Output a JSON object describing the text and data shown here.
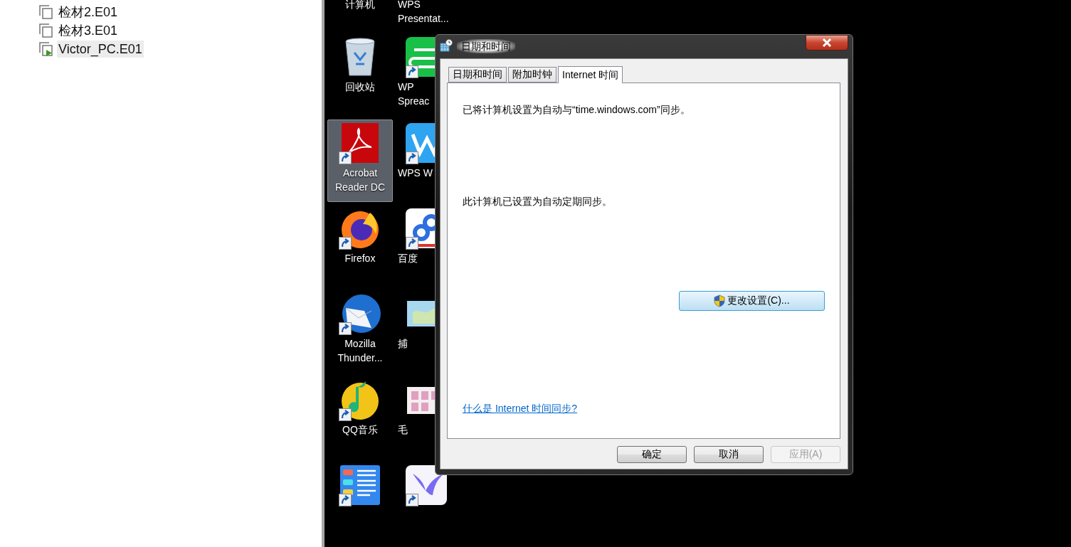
{
  "file_tree": {
    "items": [
      {
        "label": "检材2.E01",
        "selected": false,
        "active": false
      },
      {
        "label": "检材3.E01",
        "selected": false,
        "active": false
      },
      {
        "label": "Victor_PC.E01",
        "selected": true,
        "active": true
      }
    ]
  },
  "desktop": {
    "columns": [
      {
        "icons": [
          {
            "lines": [
              "计算机"
            ],
            "selected": false
          },
          {
            "kind": "trash",
            "lines": [
              "回收站"
            ],
            "selected": false,
            "shortcut": false
          },
          {
            "kind": "pdf",
            "lines": [
              "Acrobat",
              "Reader DC"
            ],
            "selected": true,
            "shortcut": true
          },
          {
            "kind": "fox",
            "lines": [
              "Firefox"
            ],
            "selected": false,
            "shortcut": true
          },
          {
            "kind": "mail",
            "lines": [
              "Mozilla",
              "Thunder..."
            ],
            "selected": false,
            "shortcut": true
          },
          {
            "kind": "music",
            "lines": [
              "QQ音乐"
            ],
            "selected": false,
            "shortcut": true
          },
          {
            "kind": "list",
            "selected": false,
            "shortcut": true
          }
        ]
      },
      {
        "icons": [
          {
            "lines": [
              "WPS",
              "Presentat..."
            ],
            "selected": false
          },
          {
            "kind": "sheet",
            "lines": [
              "WP",
              "Spreac"
            ],
            "selected": false,
            "shortcut": true
          },
          {
            "kind": "writer",
            "lines": [
              "WPS W"
            ],
            "selected": false,
            "shortcut": true
          },
          {
            "kind": "cloud",
            "lines": [
              "百度"
            ],
            "selected": false,
            "shortcut": true
          },
          {
            "kind": "map",
            "lines": [
              "捕"
            ],
            "selected": false,
            "shortcut": false
          },
          {
            "kind": "doc",
            "lines": [
              "毛"
            ],
            "selected": false,
            "shortcut": false
          },
          {
            "kind": "bird",
            "selected": false,
            "shortcut": true
          }
        ]
      }
    ]
  },
  "dialog": {
    "title": "日期和时间",
    "tabs": [
      {
        "label": "日期和时间",
        "selected": false
      },
      {
        "label": "附加时钟",
        "selected": false
      },
      {
        "label": "Internet 时间",
        "selected": true
      }
    ],
    "panel": {
      "status": "已将计算机设置为自动与“time.windows.com”同步。",
      "note": "此计算机已设置为自动定期同步。",
      "change_button": "更改设置(C)...",
      "link": "什么是 Internet 时间同步?"
    },
    "buttons": [
      {
        "label": "确定",
        "disabled": false
      },
      {
        "label": "取消",
        "disabled": false
      },
      {
        "label": "应用(A)",
        "disabled": true
      }
    ]
  }
}
